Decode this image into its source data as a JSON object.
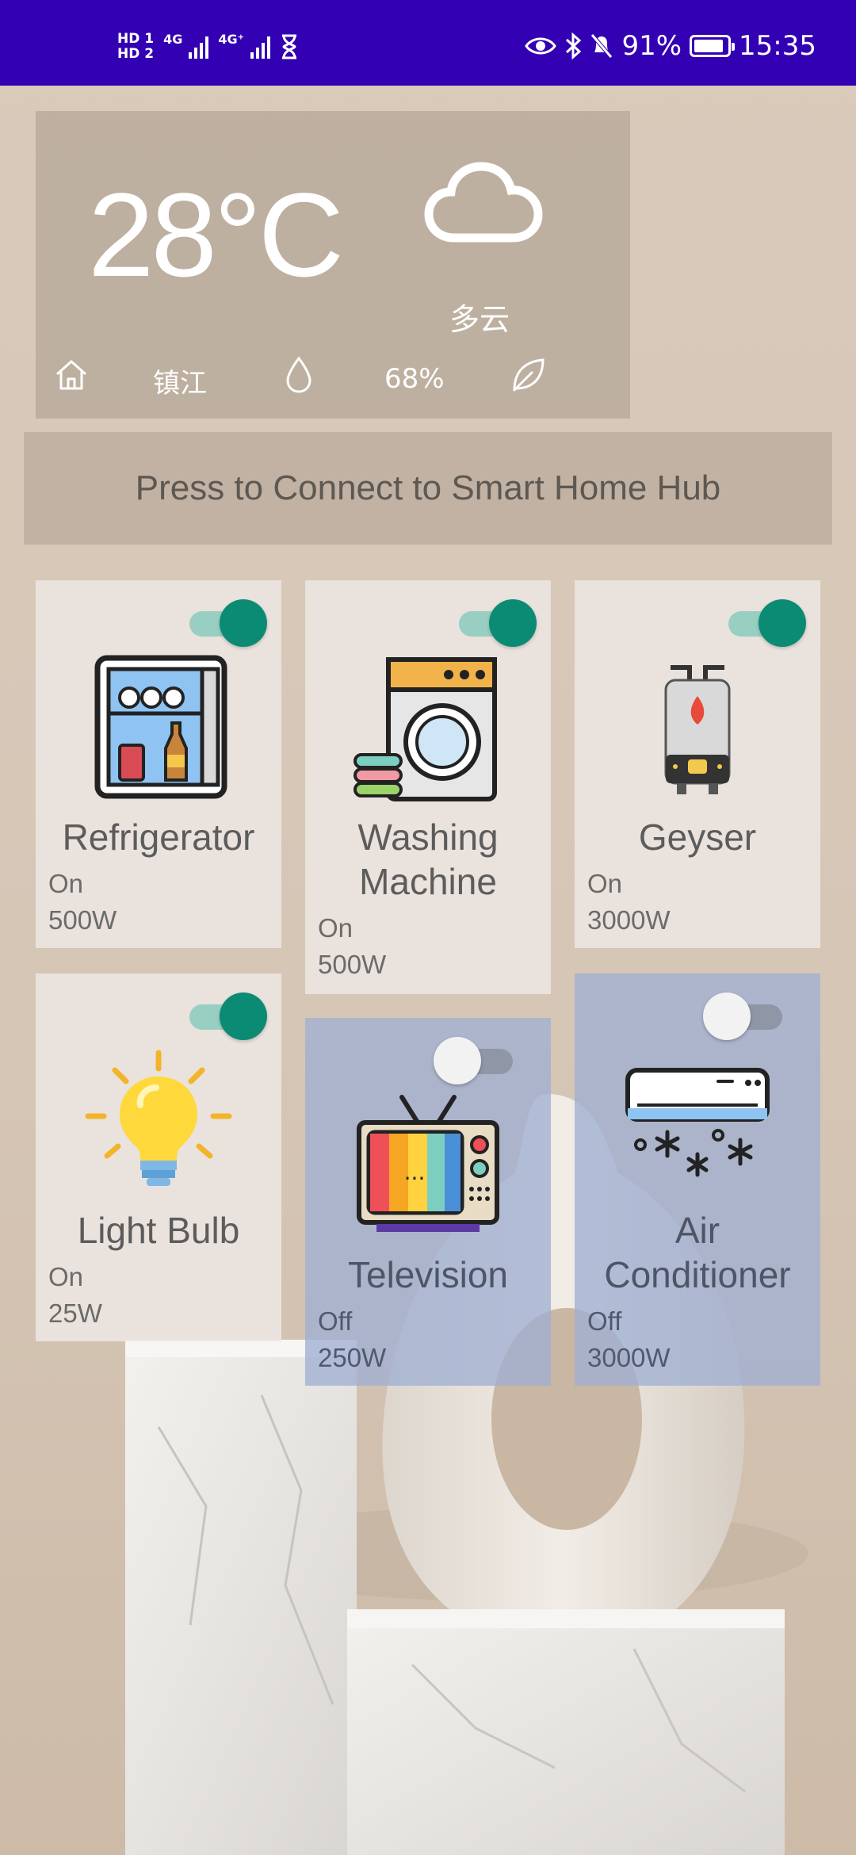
{
  "status_bar": {
    "hd1": "HD 1",
    "hd2": "HD 2",
    "net1": "4G",
    "net2": "4G⁺",
    "battery_percent": "91%",
    "battery_level": 0.91,
    "time": "15:35"
  },
  "weather": {
    "temperature": "28°C",
    "condition": "多云",
    "city": "镇江",
    "humidity": "68%"
  },
  "connect_button": {
    "label": "Press to Connect to Smart Home Hub"
  },
  "devices": [
    {
      "name": "Refrigerator",
      "status": "On",
      "power": "500W",
      "enabled": true,
      "icon": "refrigerator-icon"
    },
    {
      "name": "Washing Machine",
      "status": "On",
      "power": "500W",
      "enabled": true,
      "icon": "washing-machine-icon"
    },
    {
      "name": "Geyser",
      "status": "On",
      "power": "3000W",
      "enabled": true,
      "icon": "geyser-icon"
    },
    {
      "name": "Light Bulb",
      "status": "On",
      "power": "25W",
      "enabled": true,
      "icon": "light-bulb-icon"
    },
    {
      "name": "Television",
      "status": "Off",
      "power": "250W",
      "enabled": false,
      "icon": "television-icon"
    },
    {
      "name": "Air Conditioner",
      "status": "Off",
      "power": "3000W",
      "enabled": false,
      "icon": "air-conditioner-icon"
    }
  ],
  "colors": {
    "status_bar": "#3300b3",
    "toggle_on": "#0b8a74",
    "card_off": "#a0afd2"
  }
}
